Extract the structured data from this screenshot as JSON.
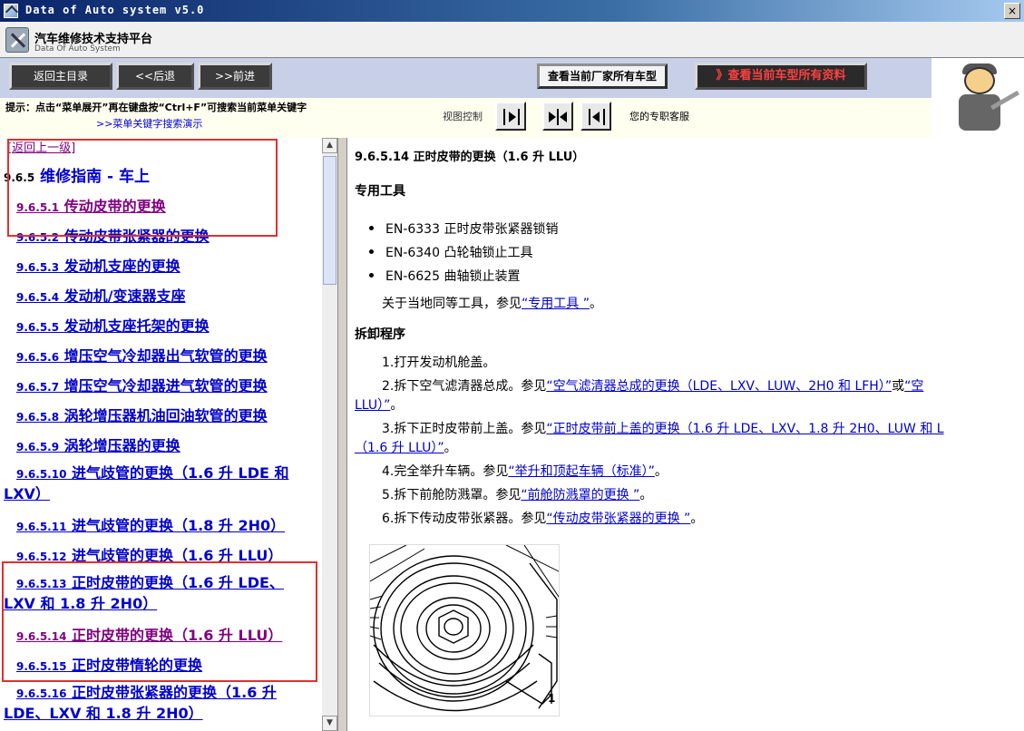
{
  "window": {
    "title": "Data of Auto system v5.0",
    "close_label": "×"
  },
  "header": {
    "title": "汽车维修技术支持平台",
    "subtitle": "Data Of Auto System"
  },
  "toolbar": {
    "back_main": "返回主目录",
    "back": "<<后退",
    "forward": ">>前进",
    "view_makers": "查看当前厂家所有车型",
    "view_all": "》查看当前车型所有资料"
  },
  "tips": {
    "line1": "提示：点击“菜单展开”再在键盘按“Ctrl+F”可搜索当前菜单关键字",
    "line2": ">>菜单关键字搜索演示",
    "view_control": "视图控制",
    "agent": "您的专职客服"
  },
  "nav": {
    "up": "[返回上一级]",
    "section_num": "9.6.5",
    "section_title": "维修指南 - 车上",
    "items": [
      {
        "num": "9.6.5.1",
        "label": "传动皮带的更换"
      },
      {
        "num": "9.6.5.2",
        "label": "传动皮带张紧器的更换"
      },
      {
        "num": "9.6.5.3",
        "label": "发动机支座的更换"
      },
      {
        "num": "9.6.5.4",
        "label": "发动机/变速器支座"
      },
      {
        "num": "9.6.5.5",
        "label": "发动机支座托架的更换"
      },
      {
        "num": "9.6.5.6",
        "label": "增压空气冷却器出气软管的更换"
      },
      {
        "num": "9.6.5.7",
        "label": "增压空气冷却器进气软管的更换"
      },
      {
        "num": "9.6.5.8",
        "label": "涡轮增压器机油回油软管的更换"
      },
      {
        "num": "9.6.5.9",
        "label": "涡轮增压器的更换"
      },
      {
        "num": "9.6.5.10",
        "label": "进气歧管的更换（1.6 升 LDE 和 LXV）"
      },
      {
        "num": "9.6.5.11",
        "label": "进气歧管的更换（1.8 升 2H0）"
      },
      {
        "num": "9.6.5.12",
        "label": "进气歧管的更换（1.6 升 LLU）"
      },
      {
        "num": "9.6.5.13",
        "label": "正时皮带的更换（1.6 升 LDE、LXV 和 1.8 升 2H0）"
      },
      {
        "num": "9.6.5.14",
        "label": "正时皮带的更换（1.6 升 LLU）"
      },
      {
        "num": "9.6.5.15",
        "label": "正时皮带惰轮的更换"
      },
      {
        "num": "9.6.5.16",
        "label": "正时皮带张紧器的更换（1.6 升 LDE、LXV 和 1.8 升 2H0）"
      }
    ]
  },
  "content": {
    "title": "9.6.5.14 正时皮带的更换（1.6 升  LLU）",
    "tools_heading": "专用工具",
    "tools": [
      "EN-6333 正时皮带张紧器锁销",
      "EN-6340 凸轮轴锁止工具",
      "EN-6625 曲轴锁止装置"
    ],
    "equiv_pre": "关于当地同等工具，参见",
    "equiv_link": "“专用工具 ”",
    "equiv_post": "。",
    "procedure_heading": "拆卸程序",
    "steps": {
      "s1": "1.打开发动机舱盖。",
      "s2_pre": "2.拆下空气滤清器总成。参见",
      "s2_link1": "“空气滤清器总成的更换（LDE、LXV、LUW、2H0 和  LFH）”",
      "s2_mid": "或",
      "s2_link2": "“空",
      "s2_cont_link": "LLU）”",
      "s2_cont_post": "。",
      "s3_pre": "3.拆下正时皮带前上盖。参见",
      "s3_link": "“正时皮带前上盖的更换（1.6 升  LDE、LXV、1.8 升  2H0、LUW 和  L",
      "s3_cont_link": "（1.6 升  LLU）”",
      "s3_cont_post": "。",
      "s4_pre": "4.完全举升车辆。参见",
      "s4_link": "“举升和顶起车辆（标准）”",
      "s4_post": "。",
      "s5_pre": "5.拆下前舱防溅罩。参见",
      "s5_link": "“前舱防溅罩的更换 ”",
      "s5_post": "。",
      "s6_pre": "6.拆下传动皮带张紧器。参见",
      "s6_link": "“传动皮带张紧器的更换 ”",
      "s6_post": "。"
    },
    "figure_callout": "1"
  }
}
